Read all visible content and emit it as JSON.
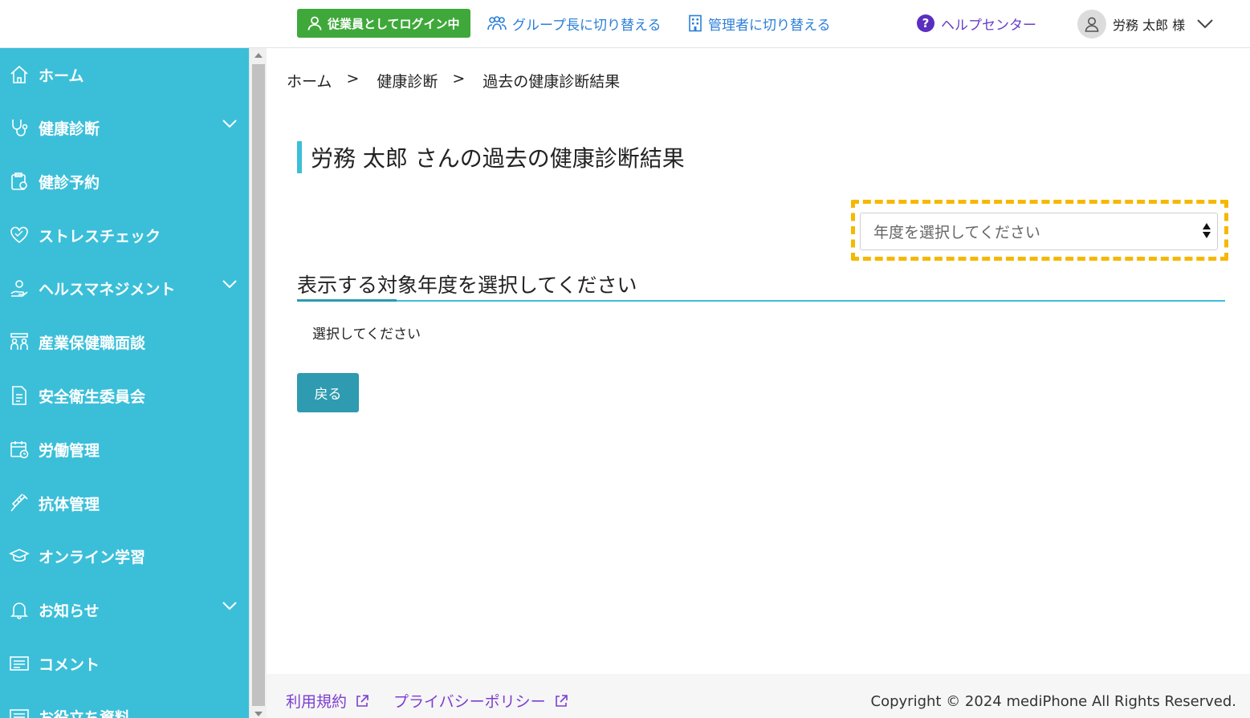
{
  "header": {
    "login_status": "従業員としてログイン中",
    "switch_group": "グループ長に切り替える",
    "switch_admin": "管理者に切り替える",
    "help": "ヘルプセンター",
    "user_name": "労務 太郎 様"
  },
  "sidebar": {
    "items": [
      {
        "label": "ホーム",
        "icon": "home-icon"
      },
      {
        "label": "健康診断",
        "icon": "stethoscope-icon"
      },
      {
        "label": "健診予約",
        "icon": "calendar-clipboard-icon"
      },
      {
        "label": "ストレスチェック",
        "icon": "heart-icon"
      },
      {
        "label": "ヘルスマネジメント",
        "icon": "health-hand-icon"
      },
      {
        "label": "産業保健職面談",
        "icon": "meeting-icon"
      },
      {
        "label": "安全衛生委員会",
        "icon": "document-icon"
      },
      {
        "label": "労働管理",
        "icon": "calendar-clock-icon"
      },
      {
        "label": "抗体管理",
        "icon": "syringe-icon"
      },
      {
        "label": "オンライン学習",
        "icon": "graduation-cap-icon"
      },
      {
        "label": "お知らせ",
        "icon": "bell-icon"
      },
      {
        "label": "コメント",
        "icon": "comment-icon"
      },
      {
        "label": "お役立ち資料",
        "icon": "book-icon"
      }
    ]
  },
  "breadcrumb": [
    "ホーム",
    "健康診断",
    "過去の健康診断結果"
  ],
  "breadcrumb_sep": ">",
  "main": {
    "title": "労務 太郎 さんの過去の健康診断結果",
    "year_select_placeholder": "年度を選択してください",
    "section_heading": "表示する対象年度を選択してください",
    "placeholder_text": "選択してください",
    "back_label": "戻る"
  },
  "footer": {
    "terms": "利用規約",
    "privacy": "プライバシーポリシー",
    "copyright": "Copyright © 2024 mediPhone All Rights Reserved."
  },
  "colors": {
    "sidebar": "#3bbfd9",
    "login_badge": "#3fa83a",
    "button": "#2e9bb0",
    "highlight": "#f5b800",
    "link": "#2b7fd8",
    "footer_link": "#7b3fd1"
  }
}
